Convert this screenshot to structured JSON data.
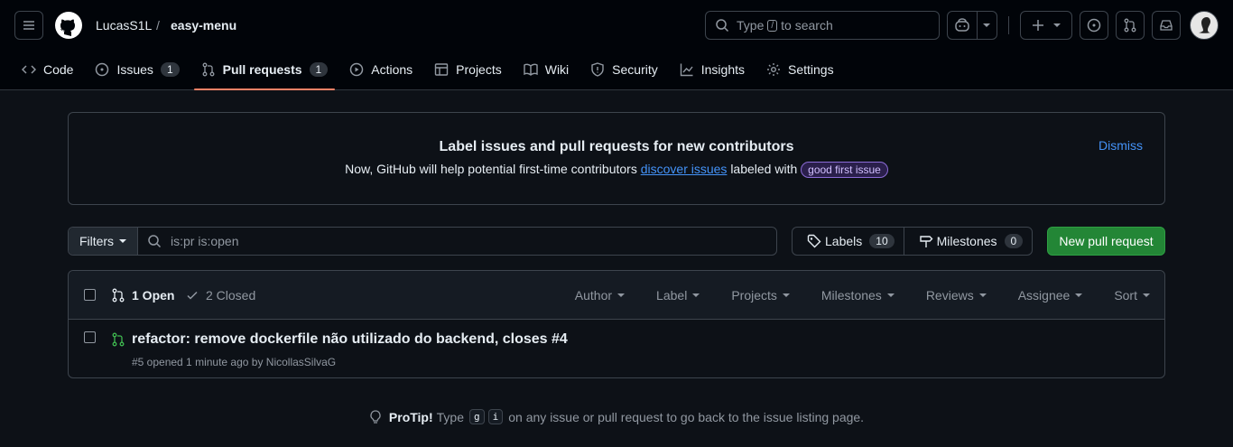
{
  "repo": {
    "owner": "LucasS1L",
    "separator": "/",
    "name": "easy-menu"
  },
  "search": {
    "prefix": "Type",
    "key": "/",
    "suffix": "to search"
  },
  "tabs": [
    {
      "label": "Code",
      "icon": "code-icon"
    },
    {
      "label": "Issues",
      "icon": "issue-opened-icon",
      "count": "1"
    },
    {
      "label": "Pull requests",
      "icon": "git-pull-request-icon",
      "count": "1",
      "active": true
    },
    {
      "label": "Actions",
      "icon": "play-icon"
    },
    {
      "label": "Projects",
      "icon": "table-icon"
    },
    {
      "label": "Wiki",
      "icon": "book-icon"
    },
    {
      "label": "Security",
      "icon": "shield-icon"
    },
    {
      "label": "Insights",
      "icon": "graph-icon"
    },
    {
      "label": "Settings",
      "icon": "gear-icon"
    }
  ],
  "banner": {
    "title": "Label issues and pull requests for new contributors",
    "text_before": "Now, GitHub will help potential first-time contributors",
    "link": "discover issues",
    "text_after": "labeled with",
    "label": "good first issue",
    "dismiss": "Dismiss"
  },
  "filters": {
    "button": "Filters",
    "query": "is:pr is:open"
  },
  "labels": {
    "label": "Labels",
    "count": "10"
  },
  "milestones": {
    "label": "Milestones",
    "count": "0"
  },
  "new_pr": "New pull request",
  "list": {
    "open": "1 Open",
    "closed": "2 Closed",
    "sorts": [
      "Author",
      "Label",
      "Projects",
      "Milestones",
      "Reviews",
      "Assignee",
      "Sort"
    ],
    "items": [
      {
        "title": "refactor: remove dockerfile não utilizado do backend, closes #4",
        "meta": "#5 opened 1 minute ago by NicollasSilvaG"
      }
    ]
  },
  "protip": {
    "label": "ProTip!",
    "before": "Type",
    "key1": "g",
    "key2": "i",
    "after": "on any issue or pull request to go back to the issue listing page."
  },
  "colors": {
    "background": "#0d1117",
    "accent": "#f78166",
    "link": "#4493f8",
    "primary": "#238636",
    "open": "#3fb950"
  }
}
